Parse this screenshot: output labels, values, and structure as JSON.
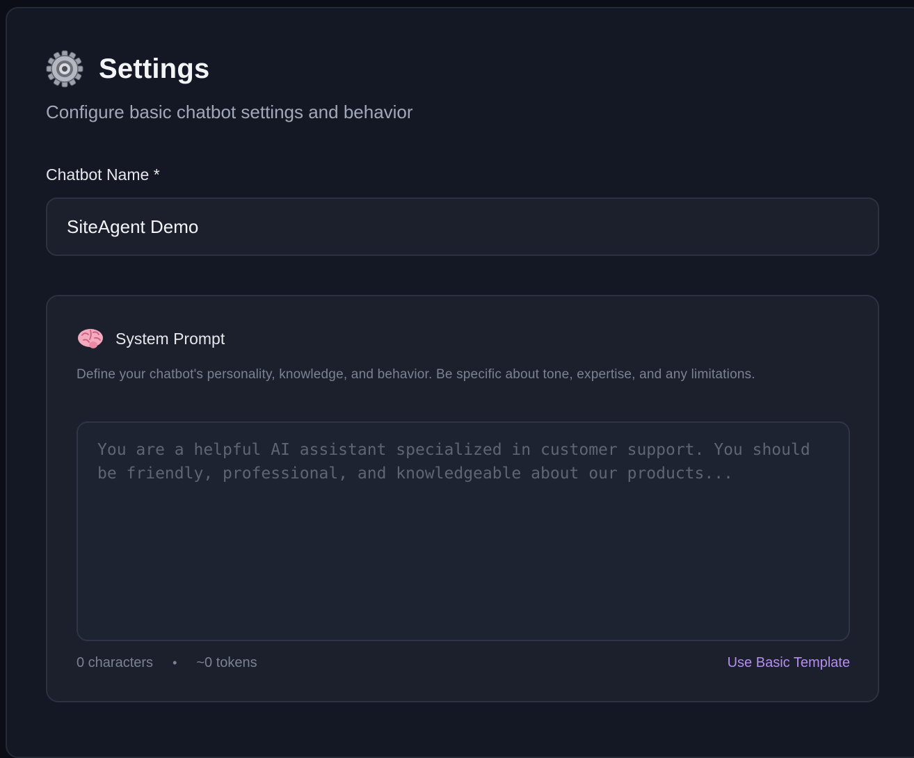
{
  "header": {
    "icon": "gear-icon",
    "title": "Settings",
    "subtitle": "Configure basic chatbot settings and behavior"
  },
  "chatbot_name": {
    "label": "Chatbot Name *",
    "value": "SiteAgent Demo"
  },
  "system_prompt": {
    "icon": "brain-icon",
    "title": "System Prompt",
    "description": "Define your chatbot's personality, knowledge, and behavior. Be specific about tone, expertise, and any limitations.",
    "value": "",
    "placeholder": "You are a helpful AI assistant specialized in customer support. You should be friendly, professional, and knowledgeable about our products...",
    "char_count": "0 characters",
    "separator": "•",
    "token_count": "~0 tokens",
    "template_link": "Use Basic Template"
  },
  "colors": {
    "background": "#141824",
    "card": "#1b202c",
    "accent_link": "#b48ef0"
  }
}
